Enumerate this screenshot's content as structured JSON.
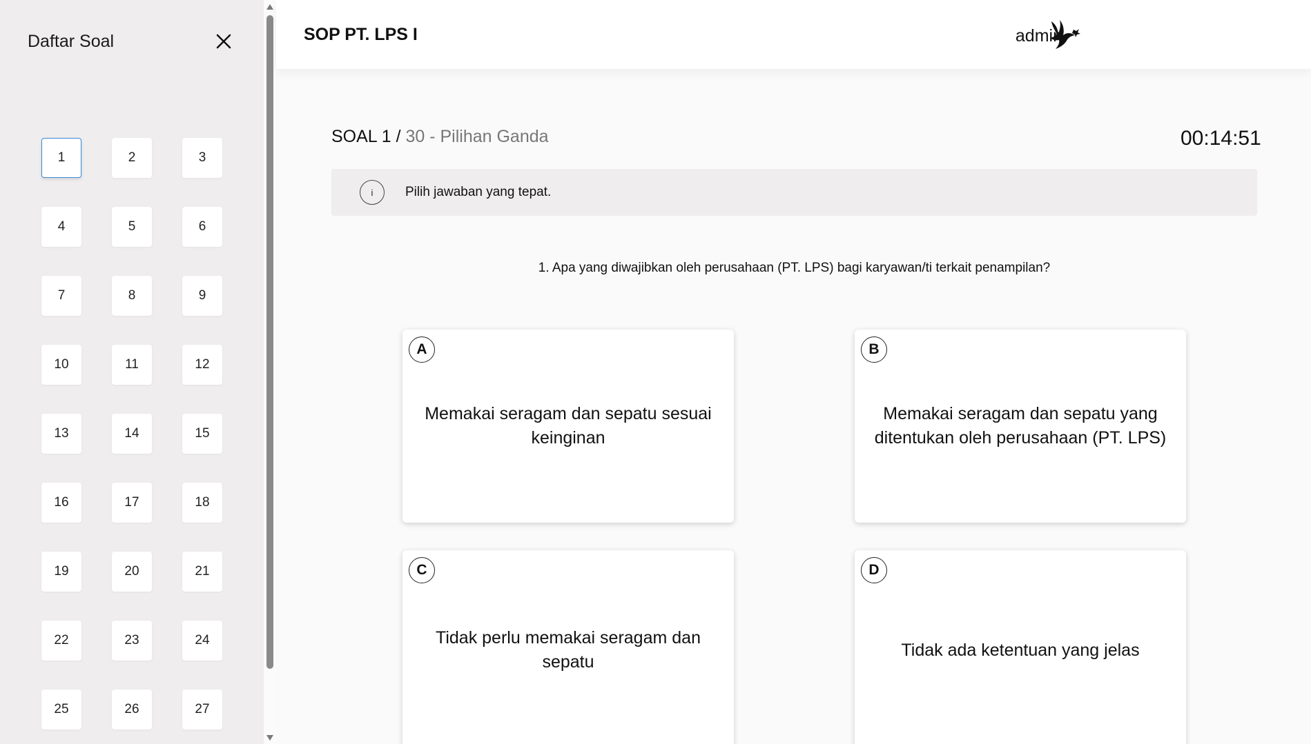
{
  "sidebar": {
    "title": "Daftar Soal",
    "questions": [
      "1",
      "2",
      "3",
      "4",
      "5",
      "6",
      "7",
      "8",
      "9",
      "10",
      "11",
      "12",
      "13",
      "14",
      "15",
      "16",
      "17",
      "18",
      "19",
      "20",
      "21",
      "22",
      "23",
      "24",
      "25",
      "26",
      "27"
    ],
    "active_question": "1"
  },
  "header": {
    "title": "SOP PT. LPS I",
    "user": "admin"
  },
  "soal": {
    "label": "SOAL 1 /",
    "total_and_type": "30 - Pilihan Ganda",
    "timer": "00:14:51",
    "info_icon": "i",
    "instruction": "Pilih jawaban yang tepat.",
    "question": "1. Apa yang diwajibkan oleh perusahaan (PT. LPS) bagi karyawan/ti terkait penampilan?"
  },
  "options": [
    {
      "letter": "A",
      "text": "Memakai seragam dan sepatu sesuai keinginan"
    },
    {
      "letter": "B",
      "text": "Memakai seragam dan sepatu yang ditentukan oleh perusahaan (PT. LPS)"
    },
    {
      "letter": "C",
      "text": "Tidak perlu memakai seragam dan sepatu"
    },
    {
      "letter": "D",
      "text": "Tidak ada ketentuan yang jelas"
    }
  ],
  "icons": {
    "close": "close-icon",
    "logo": "bird-logo-icon",
    "info": "info-icon"
  },
  "colors": {
    "sidebar_bg": "#efedee",
    "active_border": "#3d8bd9",
    "info_bg": "#efedee"
  }
}
